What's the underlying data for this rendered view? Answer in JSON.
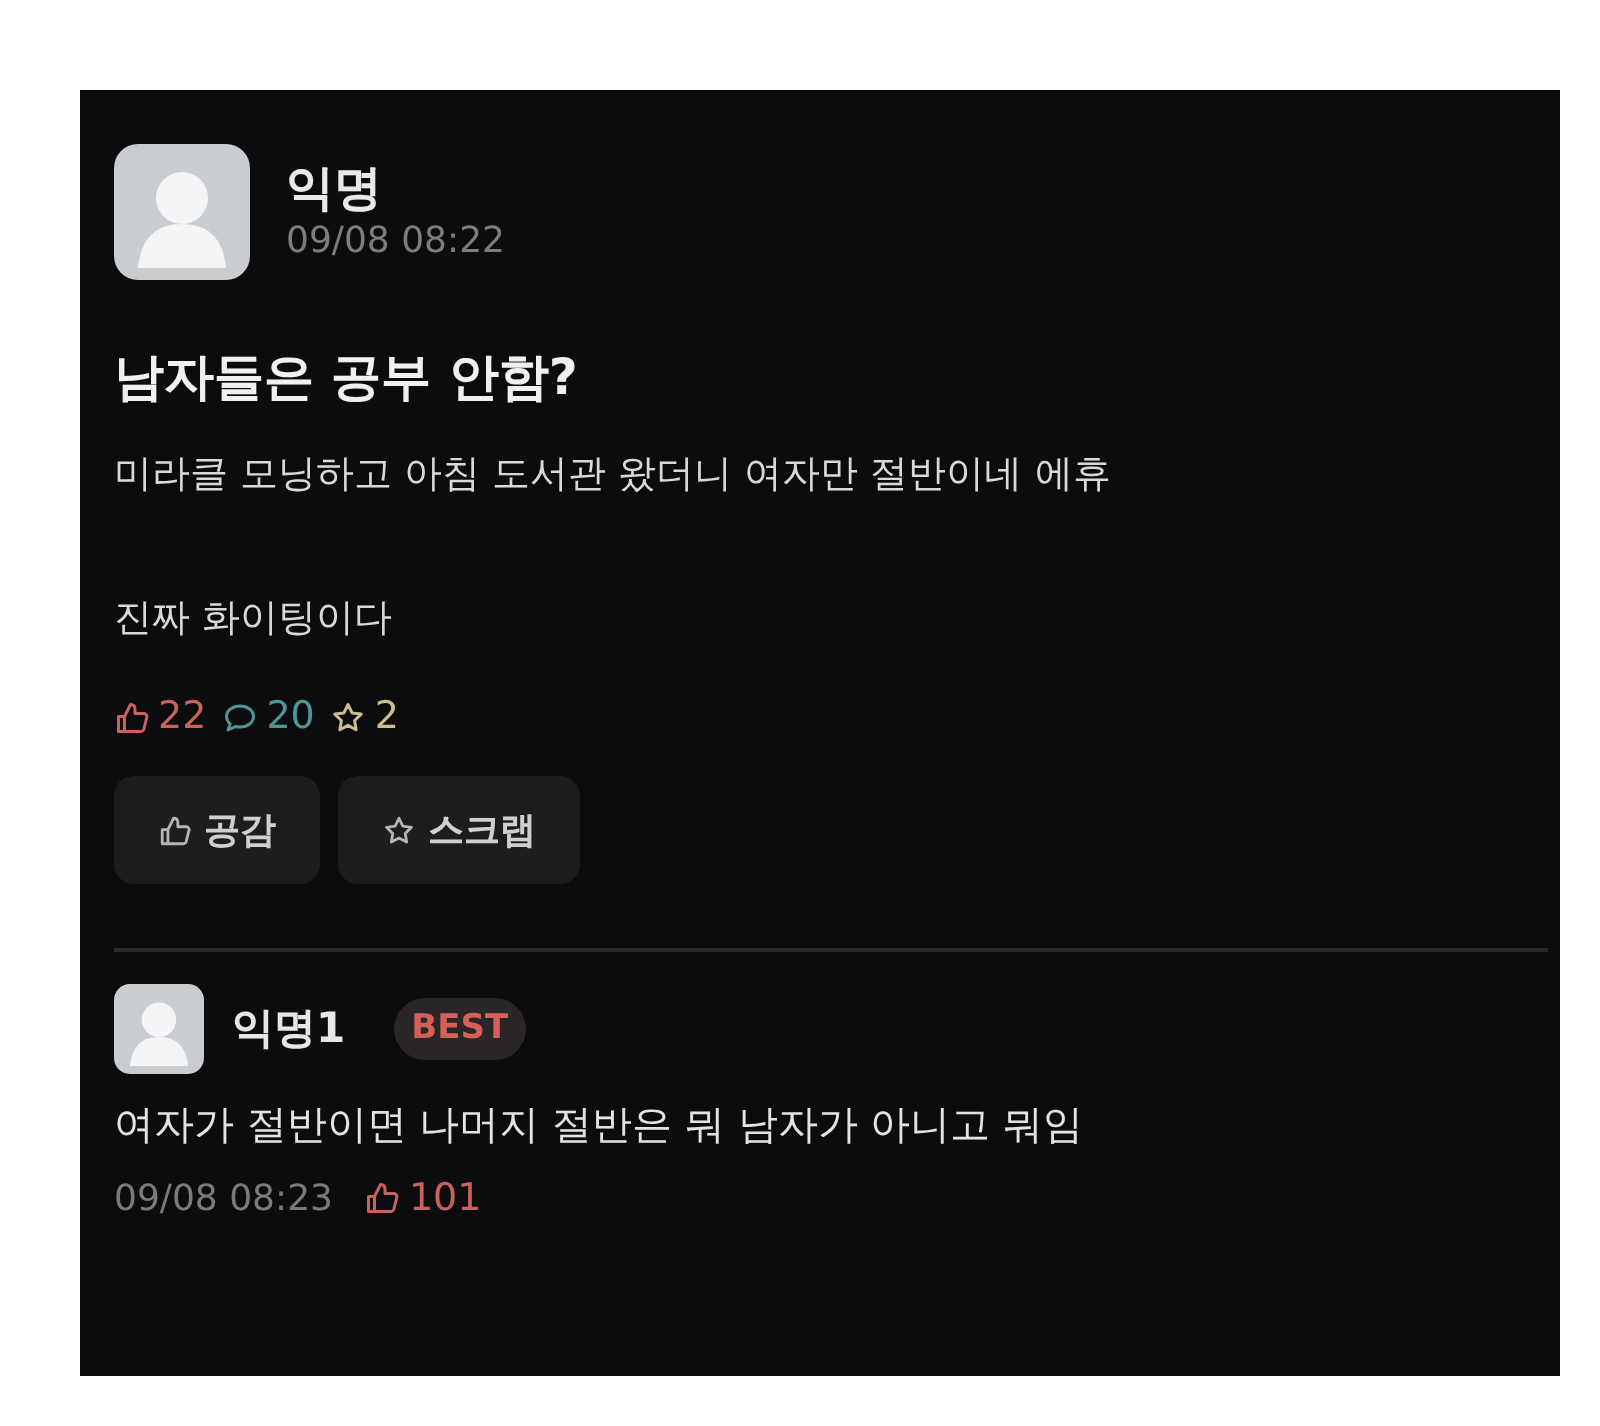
{
  "post": {
    "author": "익명",
    "time": "09/08 08:22",
    "title": "남자들은 공부 안함?",
    "paragraphs": [
      "미라클 모닝하고 아침 도서관 왔더니 여자만 절반이네 에휴",
      "진짜 화이팅이다"
    ],
    "stats": [
      {
        "kind": "like",
        "count": "22",
        "color": "#c8625c"
      },
      {
        "kind": "comment",
        "count": "20",
        "color": "#4f9496"
      },
      {
        "kind": "scrap",
        "count": "2",
        "color": "#cdbd8e"
      }
    ],
    "buttons": [
      {
        "kind": "like",
        "label": "공감"
      },
      {
        "kind": "scrap",
        "label": "스크랩"
      }
    ]
  },
  "comments": [
    {
      "author": "익명1",
      "badge": "BEST",
      "text": "여자가 절반이면 나머지 절반은 뭐 남자가 아니고 뭐임",
      "time": "09/08 08:23",
      "likes": "101"
    }
  ]
}
